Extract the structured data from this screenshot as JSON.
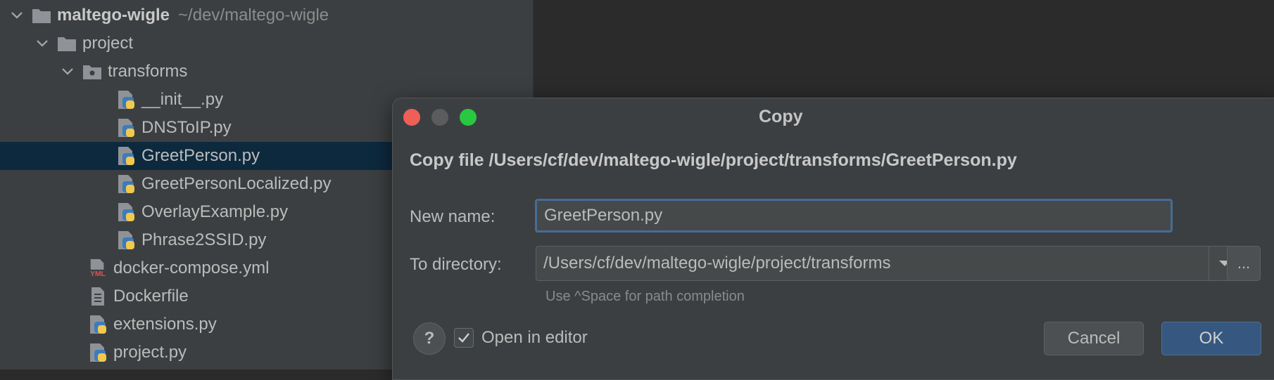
{
  "tree": {
    "root": {
      "label": "maltego-wigle",
      "path": "~/dev/maltego-wigle"
    },
    "items": [
      {
        "label": "project"
      },
      {
        "label": "transforms"
      },
      {
        "label": "__init__.py"
      },
      {
        "label": "DNSToIP.py"
      },
      {
        "label": "GreetPerson.py",
        "selected": true
      },
      {
        "label": "GreetPersonLocalized.py"
      },
      {
        "label": "OverlayExample.py"
      },
      {
        "label": "Phrase2SSID.py"
      },
      {
        "label": "docker-compose.yml"
      },
      {
        "label": "Dockerfile"
      },
      {
        "label": "extensions.py"
      },
      {
        "label": "project.py"
      }
    ]
  },
  "dialog": {
    "title": "Copy",
    "heading": "Copy file /Users/cf/dev/maltego-wigle/project/transforms/GreetPerson.py",
    "new_name_label": "New name:",
    "new_name_value": "GreetPerson.py",
    "to_directory_label": "To directory:",
    "to_directory_value": "/Users/cf/dev/maltego-wigle/project/transforms",
    "browse_label": "...",
    "hint": "Use ^Space for path completion",
    "help_label": "?",
    "open_in_editor_label": "Open in editor",
    "open_in_editor_checked": true,
    "cancel_label": "Cancel",
    "ok_label": "OK"
  },
  "colors": {
    "selection": "#0d293e",
    "accent_button": "#365880",
    "focus_border": "#466d94",
    "traffic_red": "#ee5f57",
    "traffic_green": "#28c840"
  },
  "icons": {
    "folder": "folder-icon",
    "package_folder": "package-folder-icon",
    "python_file": "python-file-icon",
    "yaml_file": "yaml-file-icon",
    "text_file": "text-file-icon",
    "chevron": "chevron-down-icon"
  }
}
